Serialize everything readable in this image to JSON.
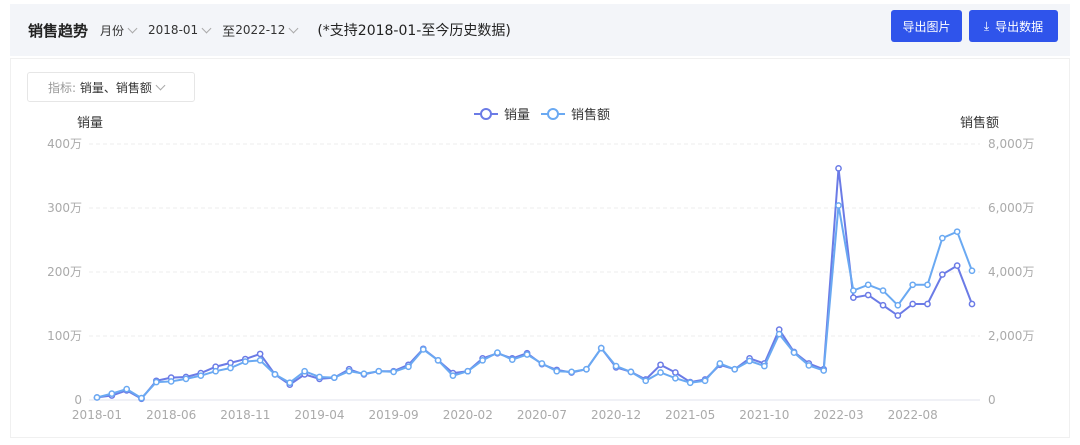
{
  "header": {
    "title": "销售趋势",
    "granularity": "月份",
    "start": "2018-01",
    "to_label": "至",
    "end": "2022-12",
    "note": "(*支持2018-01-至今历史数据)",
    "export_image": "导出图片",
    "export_data": "导出数据"
  },
  "metric": {
    "label": "指标:",
    "value": "销量、销售额"
  },
  "colors": {
    "sales_volume": "#6b7be6",
    "sales_amount": "#6aa9f2",
    "button": "#2f54eb"
  },
  "chart_data": {
    "type": "line",
    "title": "销售趋势",
    "legend": [
      "销量",
      "销售额"
    ],
    "legend_position": "top-center",
    "y_left": {
      "label": "销量",
      "ylim": [
        0,
        400
      ],
      "ticks": [
        "0",
        "100万",
        "200万",
        "300万",
        "400万"
      ]
    },
    "y_right": {
      "label": "销售额",
      "ylim": [
        0,
        8000
      ],
      "ticks": [
        "0",
        "2,000万",
        "4,000万",
        "6,000万",
        "8,000万"
      ]
    },
    "x_tick_labels": [
      "2018-01",
      "2018-06",
      "2018-11",
      "2019-04",
      "2019-09",
      "2020-02",
      "2020-07",
      "2020-12",
      "2021-05",
      "2021-10",
      "2022-03",
      "2022-08"
    ],
    "x_start": "2018-01",
    "n_months": 60,
    "series": [
      {
        "name": "销量",
        "axis": "left",
        "unit": "万",
        "values": [
          4,
          7,
          15,
          2,
          30,
          35,
          36,
          42,
          52,
          58,
          64,
          72,
          40,
          24,
          40,
          33,
          35,
          48,
          40,
          45,
          45,
          55,
          80,
          62,
          42,
          45,
          65,
          73,
          65,
          73,
          56,
          47,
          43,
          48,
          81,
          51,
          44,
          32,
          55,
          43,
          28,
          32,
          55,
          48,
          65,
          57,
          110,
          75,
          57,
          48,
          362,
          160,
          164,
          148,
          132,
          150,
          150,
          196,
          210,
          150
        ]
      },
      {
        "name": "销售额",
        "axis": "right",
        "unit": "万",
        "values": [
          80,
          200,
          340,
          60,
          560,
          580,
          660,
          760,
          900,
          1000,
          1200,
          1240,
          800,
          540,
          900,
          720,
          700,
          900,
          820,
          900,
          880,
          1040,
          1580,
          1240,
          760,
          900,
          1240,
          1480,
          1260,
          1420,
          1140,
          900,
          880,
          960,
          1620,
          1060,
          880,
          600,
          860,
          680,
          540,
          600,
          1140,
          960,
          1220,
          1060,
          2060,
          1480,
          1080,
          920,
          6080,
          3420,
          3600,
          3420,
          2960,
          3600,
          3600,
          5060,
          5260,
          4040
        ]
      }
    ]
  }
}
